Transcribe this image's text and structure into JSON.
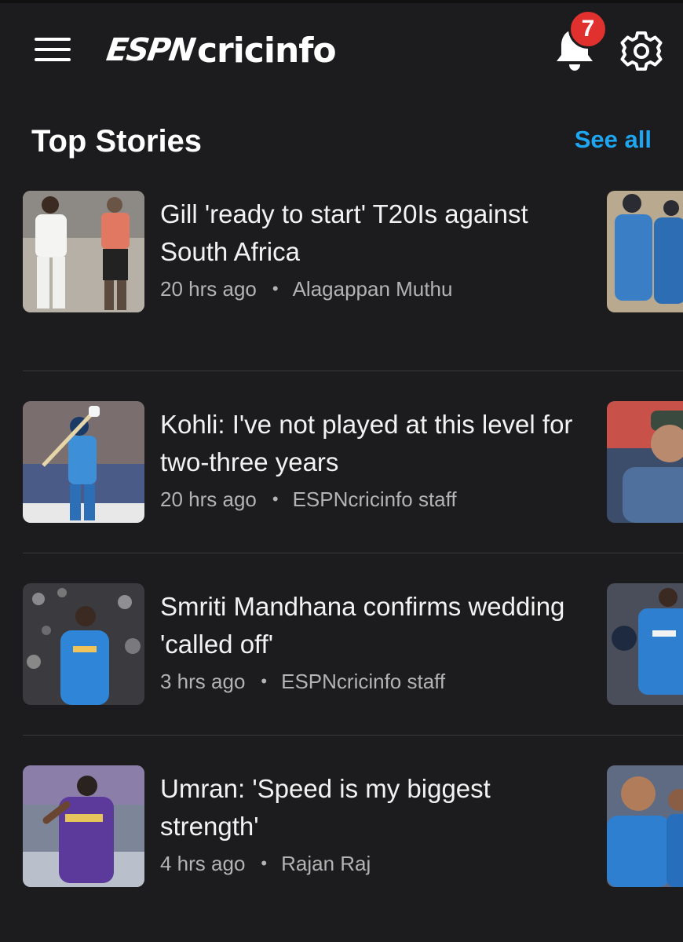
{
  "header": {
    "logo_espn": "ESPN",
    "logo_cricinfo": "cricinfo",
    "notification_count": "7",
    "icons": [
      "hamburger-menu-icon",
      "bell-icon",
      "gear-icon"
    ]
  },
  "section": {
    "title": "Top Stories",
    "see_all_label": "See all"
  },
  "stories": [
    {
      "headline": "Gill 'ready to start' T20Is against South Africa",
      "time": "20 hrs ago",
      "author": "Alagappan Muthu"
    },
    {
      "headline": "Kohli: I've not played at this level for two-three years",
      "time": "20 hrs ago",
      "author": "ESPNcricinfo staff"
    },
    {
      "headline": "Smriti Mandhana confirms wedding 'called off'",
      "time": "3 hrs ago",
      "author": "ESPNcricinfo staff"
    },
    {
      "headline": "Umran: 'Speed is my biggest strength'",
      "time": "4 hrs ago",
      "author": "Rajan Raj"
    }
  ],
  "colors": {
    "background": "#1c1c1e",
    "accent": "#1ea6f0",
    "badge": "#e0312f",
    "meta_text": "#b3b3b3",
    "divider": "#3a3a3c"
  }
}
